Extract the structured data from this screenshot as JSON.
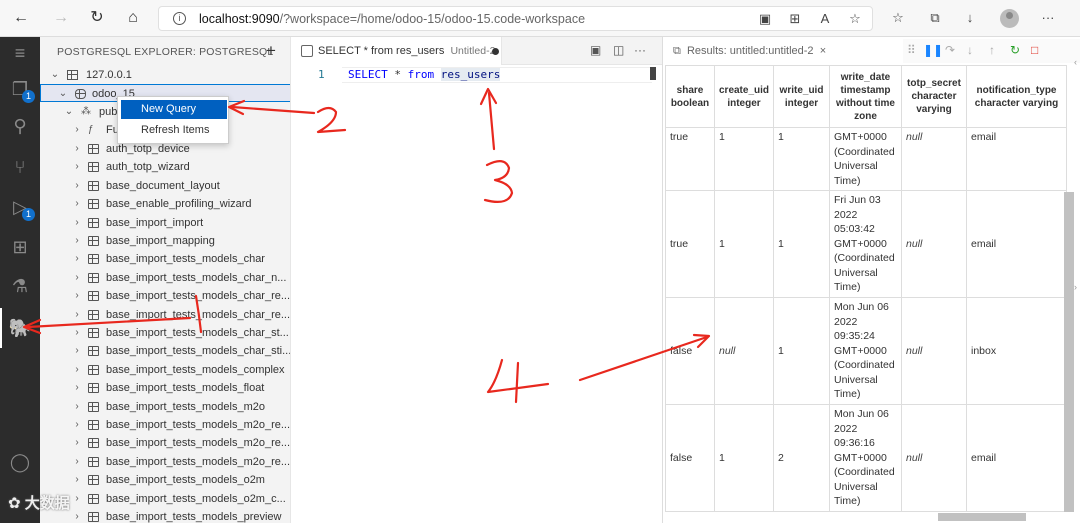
{
  "browser": {
    "url_host": "localhost:9090",
    "url_rest": "/?workspace=/home/odoo-15/odoo-15.code-workspace"
  },
  "explorer": {
    "title": "POSTGRESQL EXPLORER: POSTGRESQL",
    "server": "127.0.0.1",
    "database": "odoo_15",
    "schema": "pub",
    "functions": "Fu",
    "tables": [
      "auth_totp_device",
      "auth_totp_wizard",
      "base_document_layout",
      "base_enable_profiling_wizard",
      "base_import_import",
      "base_import_mapping",
      "base_import_tests_models_char",
      "base_import_tests_models_char_n...",
      "base_import_tests_models_char_re...",
      "base_import_tests_models_char_re...",
      "base_import_tests_models_char_st...",
      "base_import_tests_models_char_sti...",
      "base_import_tests_models_complex",
      "base_import_tests_models_float",
      "base_import_tests_models_m2o",
      "base_import_tests_models_m2o_re...",
      "base_import_tests_models_m2o_re...",
      "base_import_tests_models_m2o_re...",
      "base_import_tests_models_o2m",
      "base_import_tests_models_o2m_c...",
      "base_import_tests_models_preview"
    ]
  },
  "context_menu": {
    "new_query": "New Query",
    "refresh_items": "Refresh Items"
  },
  "editor": {
    "tab_title": "SELECT * from res_users",
    "tab_sub": "Untitled-2",
    "line_number": "1",
    "kw1": "SELECT",
    "star": " * ",
    "kw2": "from",
    "table": "res_users"
  },
  "results": {
    "tab_label": "Results: untitled:untitled-2",
    "columns": [
      {
        "name": "share",
        "type": "boolean"
      },
      {
        "name": "create_uid",
        "type": "integer"
      },
      {
        "name": "write_uid",
        "type": "integer"
      },
      {
        "name": "write_date",
        "type": "timestamp without time zone"
      },
      {
        "name": "totp_secret",
        "type": "character varying"
      },
      {
        "name": "notification_type",
        "type": "character varying"
      }
    ],
    "rows": [
      {
        "share": "true",
        "create_uid": "1",
        "write_uid": "1",
        "write_date": [
          "GMT+0000",
          "(Coordinated",
          "Universal",
          "Time)"
        ],
        "totp_secret": "null",
        "notification_type": "email"
      },
      {
        "share": "true",
        "create_uid": "1",
        "write_uid": "1",
        "write_date": [
          "Fri Jun 03",
          "2022",
          "05:03:42",
          "GMT+0000",
          "(Coordinated",
          "Universal",
          "Time)"
        ],
        "totp_secret": "null",
        "notification_type": "email"
      },
      {
        "share": "false",
        "create_uid": "null",
        "write_uid": "1",
        "write_date": [
          "Mon Jun 06",
          "2022",
          "09:35:24",
          "GMT+0000",
          "(Coordinated",
          "Universal",
          "Time)"
        ],
        "totp_secret": "null",
        "notification_type": "inbox"
      },
      {
        "share": "false",
        "create_uid": "1",
        "write_uid": "2",
        "write_date": [
          "Mon Jun 06",
          "2022",
          "09:36:16",
          "GMT+0000",
          "(Coordinated",
          "Universal",
          "Time)"
        ],
        "totp_secret": "null",
        "notification_type": "email"
      }
    ]
  },
  "annotations": [
    "1",
    "2",
    "3",
    "4"
  ],
  "activity_badges": {
    "explorer": "1",
    "debug": "1"
  },
  "colors": {
    "annotation": "#e8281e",
    "accent": "#0060c0",
    "activity_bar": "#2c2c2c"
  }
}
